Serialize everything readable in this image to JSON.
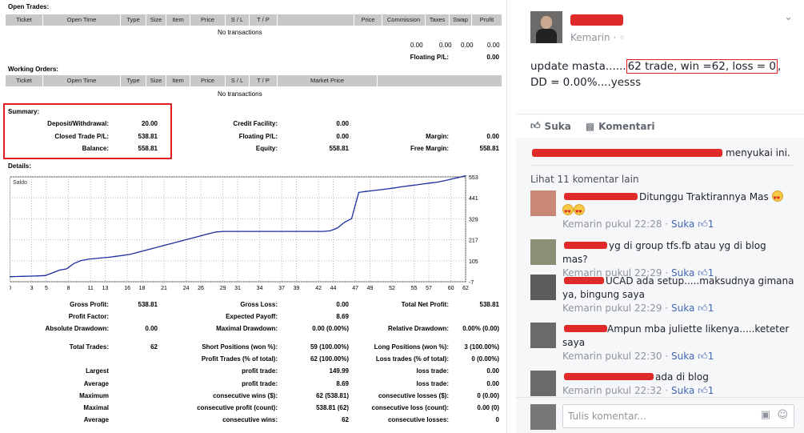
{
  "report": {
    "open_trades": {
      "title": "Open Trades:",
      "headers": [
        "Ticket",
        "Open Time",
        "Type",
        "Size",
        "Item",
        "Price",
        "S / L",
        "T / P",
        "",
        "Price",
        "Commission",
        "Taxes",
        "Swap",
        "Profit"
      ],
      "empty_text": "No transactions",
      "totals": [
        "0.00",
        "0.00",
        "0.00",
        "0.00"
      ],
      "floating_label": "Floating P/L:",
      "floating_value": "0.00"
    },
    "working_orders": {
      "title": "Working Orders:",
      "headers": [
        "Ticket",
        "Open Time",
        "Type",
        "Size",
        "Item",
        "Price",
        "S / L",
        "T / P",
        "Market Price",
        ""
      ],
      "empty_text": "No transactions"
    },
    "summary": {
      "title": "Summary:",
      "deposit_label": "Deposit/Withdrawal:",
      "deposit_value": "20.00",
      "closed_label": "Closed Trade P/L:",
      "closed_value": "538.81",
      "balance_label": "Balance:",
      "balance_value": "558.81",
      "credit_label": "Credit Facility:",
      "credit_value": "0.00",
      "floating_label": "Floating P/L:",
      "floating_value": "0.00",
      "equity_label": "Equity:",
      "equity_value": "558.81",
      "margin_label": "Margin:",
      "margin_value": "0.00",
      "free_margin_label": "Free Margin:",
      "free_margin_value": "558.81"
    },
    "details_title": "Details:",
    "stats": {
      "gross_profit_label": "Gross Profit:",
      "gross_profit_value": "538.81",
      "gross_loss_label": "Gross Loss:",
      "gross_loss_value": "0.00",
      "total_net_label": "Total Net Profit:",
      "total_net_value": "538.81",
      "profit_factor_label": "Profit Factor:",
      "expected_payoff_label": "Expected Payoff:",
      "expected_payoff_value": "8.69",
      "abs_dd_label": "Absolute Drawdown:",
      "abs_dd_value": "0.00",
      "max_dd_label": "Maximal Drawdown:",
      "max_dd_value": "0.00 (0.00%)",
      "rel_dd_label": "Relative Drawdown:",
      "rel_dd_value": "0.00% (0.00)",
      "total_trades_label": "Total Trades:",
      "total_trades_value": "62",
      "short_label": "Short Positions (won %):",
      "short_value": "59 (100.00%)",
      "long_label": "Long Positions (won %):",
      "long_value": "3 (100.00%)",
      "profit_trades_label": "Profit Trades (% of total):",
      "profit_trades_value": "62 (100.00%)",
      "loss_trades_label": "Loss trades (% of total):",
      "loss_trades_value": "0 (0.00%)",
      "largest_label": "Largest",
      "largest_profit_label": "profit trade:",
      "largest_profit_value": "149.99",
      "largest_loss_label": "loss trade:",
      "largest_loss_value": "0.00",
      "average_label": "Average",
      "average_profit_label": "profit trade:",
      "average_profit_value": "8.69",
      "average_loss_label": "loss trade:",
      "average_loss_value": "0.00",
      "maximum_label": "Maximum",
      "max_wins_label": "consecutive wins ($):",
      "max_wins_value": "62 (538.81)",
      "max_losses_label": "consecutive losses ($):",
      "max_losses_value": "0 (0.00)",
      "maximal_label": "Maximal",
      "maximal_profit_label": "consecutive profit (count):",
      "maximal_profit_value": "538.81 (62)",
      "maximal_loss_label": "consecutive loss (count):",
      "maximal_loss_value": "0.00 (0)",
      "avg2_label": "Average",
      "avg_wins_label": "consecutive wins:",
      "avg_wins_value": "62",
      "avg_losses_label": "consecutive losses:",
      "avg_losses_value": "0"
    }
  },
  "chart_data": {
    "type": "line",
    "series": [
      {
        "name": "Saldo",
        "values": [
          20,
          21,
          22,
          23,
          24,
          26,
          40,
          55,
          62,
          90,
          106,
          113,
          117,
          121,
          124,
          129,
          134,
          140,
          150,
          160,
          170,
          180,
          190,
          200,
          210,
          220,
          230,
          240,
          250,
          259,
          262,
          262,
          262,
          262,
          262,
          262,
          262,
          262,
          262,
          262,
          262,
          262,
          262,
          262,
          262,
          265,
          280,
          310,
          330,
          470,
          475,
          480,
          484,
          489,
          494,
          500,
          505,
          510,
          515,
          520,
          525,
          532,
          541,
          550,
          558.81
        ]
      }
    ],
    "x_ticks": [
      "0",
      "3",
      "5",
      "8",
      "11",
      "13",
      "16",
      "18",
      "21",
      "24",
      "26",
      "29",
      "31",
      "34",
      "37",
      "39",
      "42",
      "44",
      "47",
      "49",
      "52",
      "55",
      "57",
      "60",
      "62"
    ],
    "y_ticks": [
      "553",
      "441",
      "329",
      "217",
      "105",
      "-7"
    ],
    "ylim": [
      -7,
      553
    ],
    "grid": true
  },
  "post": {
    "time": "Kemarin",
    "text_before": "update masta......",
    "text_boxed": "62 trade, win =62, loss = 0",
    "text_after": ", DD = 0.00%....yesss",
    "like_label": "Suka",
    "comment_label": "Komentari",
    "likes_suffix": "menyukai ini.",
    "more_comments": "Lihat 11 komentar lain",
    "comments": [
      {
        "text": "Ditunggu Traktirannya Mas",
        "meta": "Kemarin pukul 22:28",
        "like": "Suka",
        "count": "1"
      },
      {
        "text": "yg di group tfs.fb atau yg di blog mas?",
        "meta": "Kemarin pukul 22:29",
        "like": "Suka",
        "count": "1"
      },
      {
        "text": "UCAD ada setup.....maksudnya gimana ya, bingung saya",
        "meta": "Kemarin pukul 22:29",
        "like": "Suka",
        "count": "1"
      },
      {
        "text": "Ampun mba juliette likenya.....keteter saya",
        "meta": "Kemarin pukul 22:30",
        "like": "Suka",
        "count": "1"
      },
      {
        "text": "ada di blog",
        "meta": "Kemarin pukul 22:32",
        "like": "Suka",
        "count": "1"
      }
    ],
    "write_placeholder": "Tulis komentar..."
  }
}
